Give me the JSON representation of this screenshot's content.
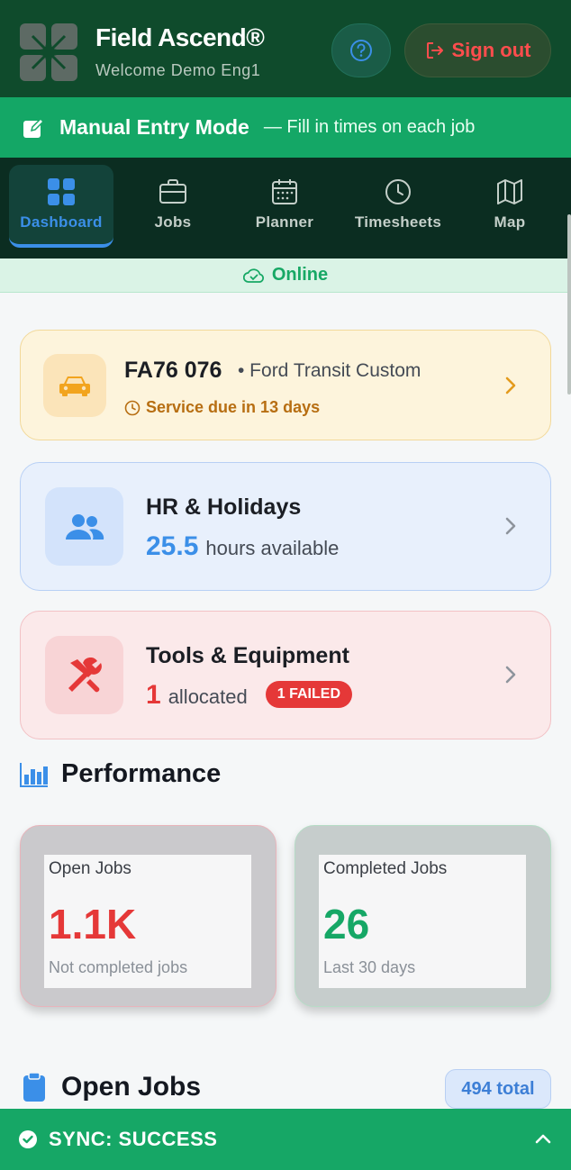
{
  "header": {
    "app_title": "Field Ascend®",
    "welcome": "Welcome Demo Eng1",
    "help_icon": "help-circle-icon",
    "signout_label": "Sign out",
    "signout_icon": "sign-out-icon"
  },
  "manual_mode": {
    "title": "Manual Entry Mode",
    "subtitle": "— Fill in times on each job"
  },
  "nav": {
    "items": [
      {
        "label": "Dashboard",
        "icon": "grid-icon",
        "active": true
      },
      {
        "label": "Jobs",
        "icon": "briefcase-icon"
      },
      {
        "label": "Planner",
        "icon": "calendar-icon"
      },
      {
        "label": "Timesheets",
        "icon": "clock-icon"
      },
      {
        "label": "Map",
        "icon": "map-icon"
      }
    ]
  },
  "status": {
    "online_label": "Online"
  },
  "vehicle": {
    "plate": "FA76 076",
    "model": "• Ford Transit Custom",
    "service_due": "Service due in 13 days"
  },
  "hr": {
    "title": "HR & Holidays",
    "hours": "25.5",
    "hours_label": "hours available"
  },
  "tools": {
    "title": "Tools & Equipment",
    "count": "1",
    "count_label": "allocated",
    "failed_badge": "1 FAILED"
  },
  "performance": {
    "title": "Performance",
    "open": {
      "label": "Open Jobs",
      "value": "1.1K",
      "sub": "Not completed jobs"
    },
    "completed": {
      "label": "Completed Jobs",
      "value": "26",
      "sub": "Last 30 days"
    }
  },
  "open_jobs": {
    "title": "Open Jobs",
    "total": "494 total"
  },
  "sync": {
    "label": "SYNC: SUCCESS"
  },
  "colors": {
    "header": "#0f4b2c",
    "accent_green": "#14a766",
    "nav_bg": "#0b2d21",
    "active_blue": "#3b8fe8",
    "danger": "#e53838"
  }
}
